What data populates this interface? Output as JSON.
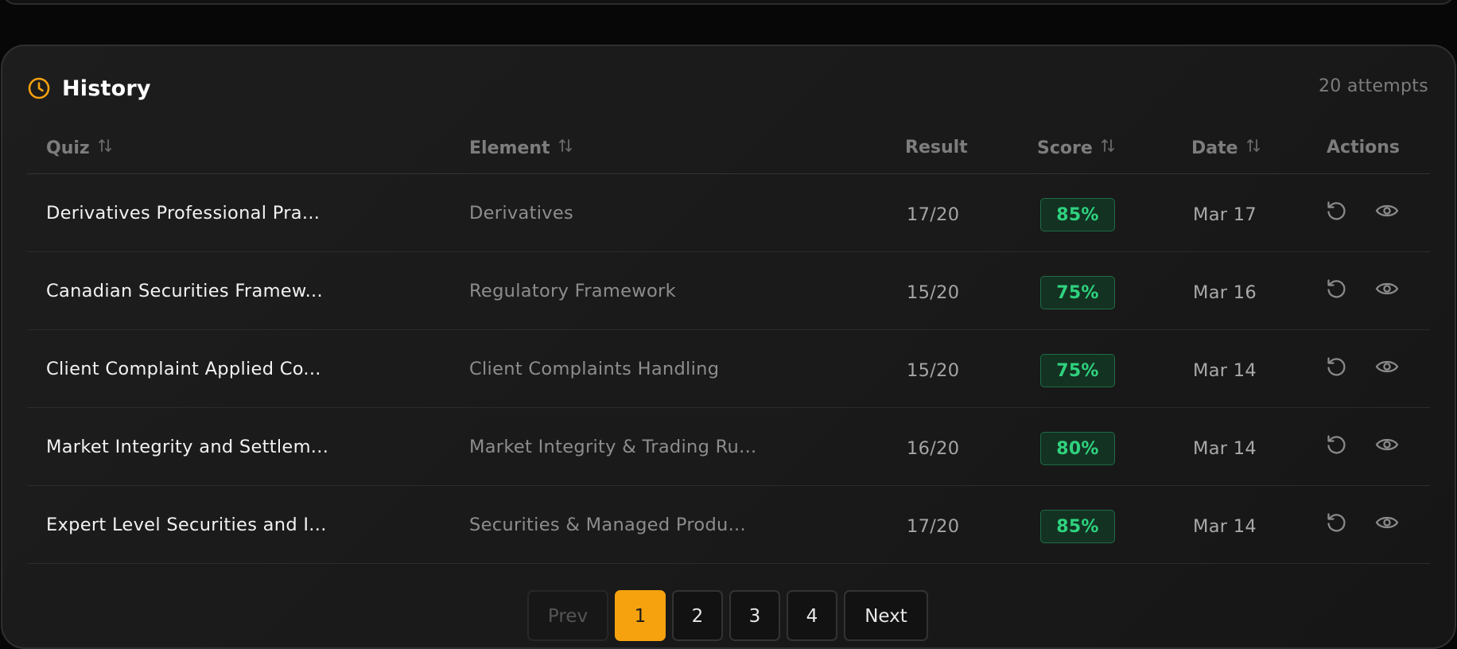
{
  "panel": {
    "title": "History",
    "attempts_label": "20 attempts",
    "icon": "clock-icon",
    "accent_color": "#f5a20e"
  },
  "table": {
    "headers": {
      "quiz": "Quiz",
      "element": "Element",
      "result": "Result",
      "score": "Score",
      "date": "Date",
      "actions": "Actions"
    },
    "rows": [
      {
        "quiz": "Derivatives Professional Pra...",
        "element": "Derivatives",
        "result": "17/20",
        "score": "85%",
        "date": "Mar 17"
      },
      {
        "quiz": "Canadian Securities Framew...",
        "element": "Regulatory Framework",
        "result": "15/20",
        "score": "75%",
        "date": "Mar 16"
      },
      {
        "quiz": "Client Complaint Applied Co...",
        "element": "Client Complaints Handling",
        "result": "15/20",
        "score": "75%",
        "date": "Mar 14"
      },
      {
        "quiz": "Market Integrity and Settlem...",
        "element": "Market Integrity & Trading Ru...",
        "result": "16/20",
        "score": "80%",
        "date": "Mar 14"
      },
      {
        "quiz": "Expert Level Securities and I...",
        "element": "Securities & Managed Produ...",
        "result": "17/20",
        "score": "85%",
        "date": "Mar 14"
      }
    ],
    "score_color": "#2fd27e"
  },
  "pagination": {
    "prev_label": "Prev",
    "pages": [
      "1",
      "2",
      "3",
      "4"
    ],
    "active_page": "1",
    "next_label": "Next"
  }
}
